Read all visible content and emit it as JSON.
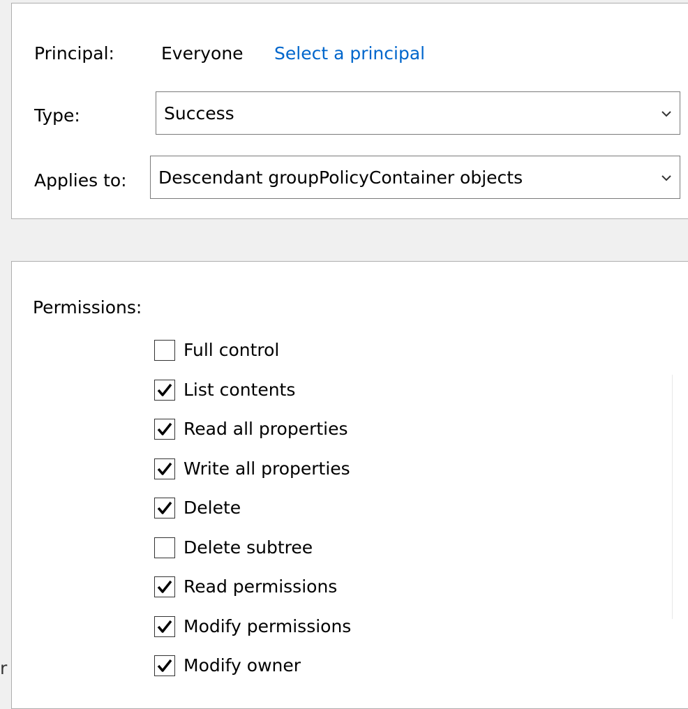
{
  "principal": {
    "label": "Principal:",
    "value": "Everyone",
    "link": "Select a principal"
  },
  "type": {
    "label": "Type:",
    "value": "Success"
  },
  "applies_to": {
    "label": "Applies to:",
    "value": "Descendant groupPolicyContainer objects"
  },
  "permissions": {
    "label": "Permissions:",
    "items": [
      {
        "label": "Full control",
        "checked": false
      },
      {
        "label": "List contents",
        "checked": true
      },
      {
        "label": "Read all properties",
        "checked": true
      },
      {
        "label": "Write all properties",
        "checked": true
      },
      {
        "label": "Delete",
        "checked": true
      },
      {
        "label": "Delete subtree",
        "checked": false
      },
      {
        "label": "Read permissions",
        "checked": true
      },
      {
        "label": "Modify permissions",
        "checked": true
      },
      {
        "label": "Modify owner",
        "checked": true
      }
    ]
  },
  "left_edge_fragment": "r",
  "colors": {
    "link": "#0066cc",
    "background": "#f0f0f0",
    "panel": "#ffffff",
    "border": "#adadad"
  }
}
